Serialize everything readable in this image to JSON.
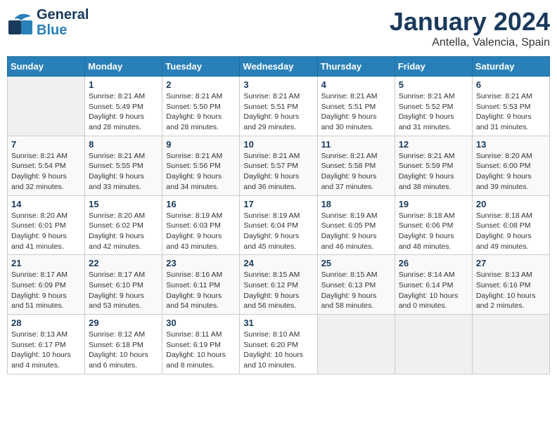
{
  "logo": {
    "line1": "General",
    "line2": "Blue"
  },
  "title": "January 2024",
  "location": "Antella, Valencia, Spain",
  "days_of_week": [
    "Sunday",
    "Monday",
    "Tuesday",
    "Wednesday",
    "Thursday",
    "Friday",
    "Saturday"
  ],
  "weeks": [
    [
      {
        "day": "",
        "info": ""
      },
      {
        "day": "1",
        "info": "Sunrise: 8:21 AM\nSunset: 5:49 PM\nDaylight: 9 hours\nand 28 minutes."
      },
      {
        "day": "2",
        "info": "Sunrise: 8:21 AM\nSunset: 5:50 PM\nDaylight: 9 hours\nand 28 minutes."
      },
      {
        "day": "3",
        "info": "Sunrise: 8:21 AM\nSunset: 5:51 PM\nDaylight: 9 hours\nand 29 minutes."
      },
      {
        "day": "4",
        "info": "Sunrise: 8:21 AM\nSunset: 5:51 PM\nDaylight: 9 hours\nand 30 minutes."
      },
      {
        "day": "5",
        "info": "Sunrise: 8:21 AM\nSunset: 5:52 PM\nDaylight: 9 hours\nand 31 minutes."
      },
      {
        "day": "6",
        "info": "Sunrise: 8:21 AM\nSunset: 5:53 PM\nDaylight: 9 hours\nand 31 minutes."
      }
    ],
    [
      {
        "day": "7",
        "info": "Sunrise: 8:21 AM\nSunset: 5:54 PM\nDaylight: 9 hours\nand 32 minutes."
      },
      {
        "day": "8",
        "info": "Sunrise: 8:21 AM\nSunset: 5:55 PM\nDaylight: 9 hours\nand 33 minutes."
      },
      {
        "day": "9",
        "info": "Sunrise: 8:21 AM\nSunset: 5:56 PM\nDaylight: 9 hours\nand 34 minutes."
      },
      {
        "day": "10",
        "info": "Sunrise: 8:21 AM\nSunset: 5:57 PM\nDaylight: 9 hours\nand 36 minutes."
      },
      {
        "day": "11",
        "info": "Sunrise: 8:21 AM\nSunset: 5:58 PM\nDaylight: 9 hours\nand 37 minutes."
      },
      {
        "day": "12",
        "info": "Sunrise: 8:21 AM\nSunset: 5:59 PM\nDaylight: 9 hours\nand 38 minutes."
      },
      {
        "day": "13",
        "info": "Sunrise: 8:20 AM\nSunset: 6:00 PM\nDaylight: 9 hours\nand 39 minutes."
      }
    ],
    [
      {
        "day": "14",
        "info": "Sunrise: 8:20 AM\nSunset: 6:01 PM\nDaylight: 9 hours\nand 41 minutes."
      },
      {
        "day": "15",
        "info": "Sunrise: 8:20 AM\nSunset: 6:02 PM\nDaylight: 9 hours\nand 42 minutes."
      },
      {
        "day": "16",
        "info": "Sunrise: 8:19 AM\nSunset: 6:03 PM\nDaylight: 9 hours\nand 43 minutes."
      },
      {
        "day": "17",
        "info": "Sunrise: 8:19 AM\nSunset: 6:04 PM\nDaylight: 9 hours\nand 45 minutes."
      },
      {
        "day": "18",
        "info": "Sunrise: 8:19 AM\nSunset: 6:05 PM\nDaylight: 9 hours\nand 46 minutes."
      },
      {
        "day": "19",
        "info": "Sunrise: 8:18 AM\nSunset: 6:06 PM\nDaylight: 9 hours\nand 48 minutes."
      },
      {
        "day": "20",
        "info": "Sunrise: 8:18 AM\nSunset: 6:08 PM\nDaylight: 9 hours\nand 49 minutes."
      }
    ],
    [
      {
        "day": "21",
        "info": "Sunrise: 8:17 AM\nSunset: 6:09 PM\nDaylight: 9 hours\nand 51 minutes."
      },
      {
        "day": "22",
        "info": "Sunrise: 8:17 AM\nSunset: 6:10 PM\nDaylight: 9 hours\nand 53 minutes."
      },
      {
        "day": "23",
        "info": "Sunrise: 8:16 AM\nSunset: 6:11 PM\nDaylight: 9 hours\nand 54 minutes."
      },
      {
        "day": "24",
        "info": "Sunrise: 8:15 AM\nSunset: 6:12 PM\nDaylight: 9 hours\nand 56 minutes."
      },
      {
        "day": "25",
        "info": "Sunrise: 8:15 AM\nSunset: 6:13 PM\nDaylight: 9 hours\nand 58 minutes."
      },
      {
        "day": "26",
        "info": "Sunrise: 8:14 AM\nSunset: 6:14 PM\nDaylight: 10 hours\nand 0 minutes."
      },
      {
        "day": "27",
        "info": "Sunrise: 8:13 AM\nSunset: 6:16 PM\nDaylight: 10 hours\nand 2 minutes."
      }
    ],
    [
      {
        "day": "28",
        "info": "Sunrise: 8:13 AM\nSunset: 6:17 PM\nDaylight: 10 hours\nand 4 minutes."
      },
      {
        "day": "29",
        "info": "Sunrise: 8:12 AM\nSunset: 6:18 PM\nDaylight: 10 hours\nand 6 minutes."
      },
      {
        "day": "30",
        "info": "Sunrise: 8:11 AM\nSunset: 6:19 PM\nDaylight: 10 hours\nand 8 minutes."
      },
      {
        "day": "31",
        "info": "Sunrise: 8:10 AM\nSunset: 6:20 PM\nDaylight: 10 hours\nand 10 minutes."
      },
      {
        "day": "",
        "info": ""
      },
      {
        "day": "",
        "info": ""
      },
      {
        "day": "",
        "info": ""
      }
    ]
  ]
}
